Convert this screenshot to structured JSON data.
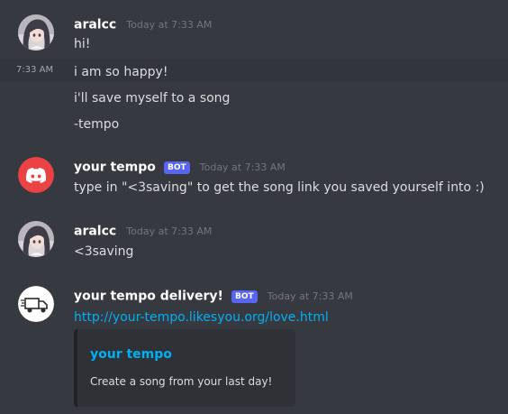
{
  "messages": [
    {
      "author": "aralcc",
      "timestamp": "Today at 7:33 AM",
      "avatar_icon": "anime-girl-avatar",
      "lines": [
        "hi!",
        "i am so happy!",
        "i'll save myself to a song",
        "-tempo"
      ],
      "hover_time": "7:33 AM"
    },
    {
      "author": "your tempo",
      "bot_tag": "BOT",
      "timestamp": "Today at 7:33 AM",
      "avatar_icon": "discord-logo-icon",
      "lines": [
        "type in \"<3saving\" to get the song link you saved yourself into :)"
      ]
    },
    {
      "author": "aralcc",
      "timestamp": "Today at 7:33 AM",
      "avatar_icon": "anime-girl-avatar",
      "lines": [
        "<3saving"
      ]
    },
    {
      "author": "your tempo delivery!",
      "bot_tag": "BOT",
      "timestamp": "Today at 7:33 AM",
      "avatar_icon": "delivery-truck-icon",
      "link": "http://your-tempo.likesyou.org/love.html",
      "embed": {
        "title": "your tempo",
        "description": "Create a song from your last day!"
      }
    }
  ],
  "colors": {
    "background": "#36393f",
    "hover_row": "#32353b",
    "link": "#00aff4",
    "bot_tag": "#5865f2",
    "discord_red": "#ed4245",
    "embed_bg": "#2f3136"
  }
}
